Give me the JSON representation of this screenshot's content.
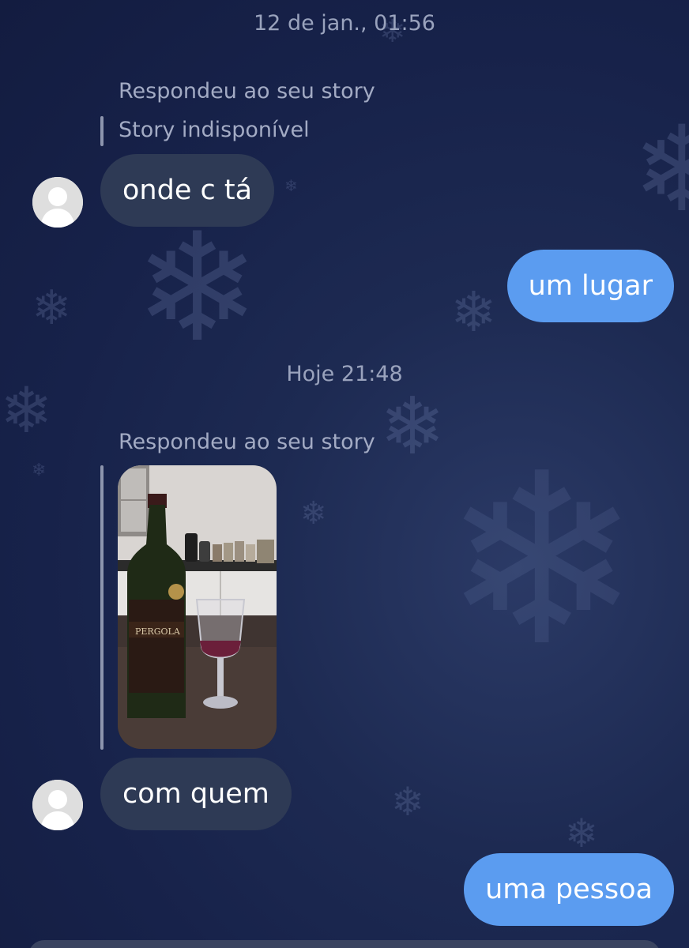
{
  "chat": {
    "timestamps": {
      "first": "12 de jan., 01:56",
      "second": "Hoje 21:48"
    },
    "story_reply_1": {
      "label": "Respondeu ao seu story",
      "story_status": "Story indisponível"
    },
    "message_1": {
      "text": "onde c tá",
      "sender": "other"
    },
    "message_2": {
      "text": "um lugar",
      "sender": "me"
    },
    "story_reply_2": {
      "label": "Respondeu ao seu story",
      "image_description": "wine-bottle-and-glass-photo"
    },
    "message_3": {
      "text": "com quem",
      "sender": "other"
    },
    "message_4": {
      "text": "uma pessoa",
      "sender": "me"
    }
  },
  "colors": {
    "background": "#1a2548",
    "incoming_bubble": "#2e3a55",
    "outgoing_bubble": "#5b9cf0",
    "meta_text": "#9aa3bd"
  },
  "icons": {
    "avatar": "default-user-avatar-icon",
    "decoration": "snowflake-icon"
  }
}
